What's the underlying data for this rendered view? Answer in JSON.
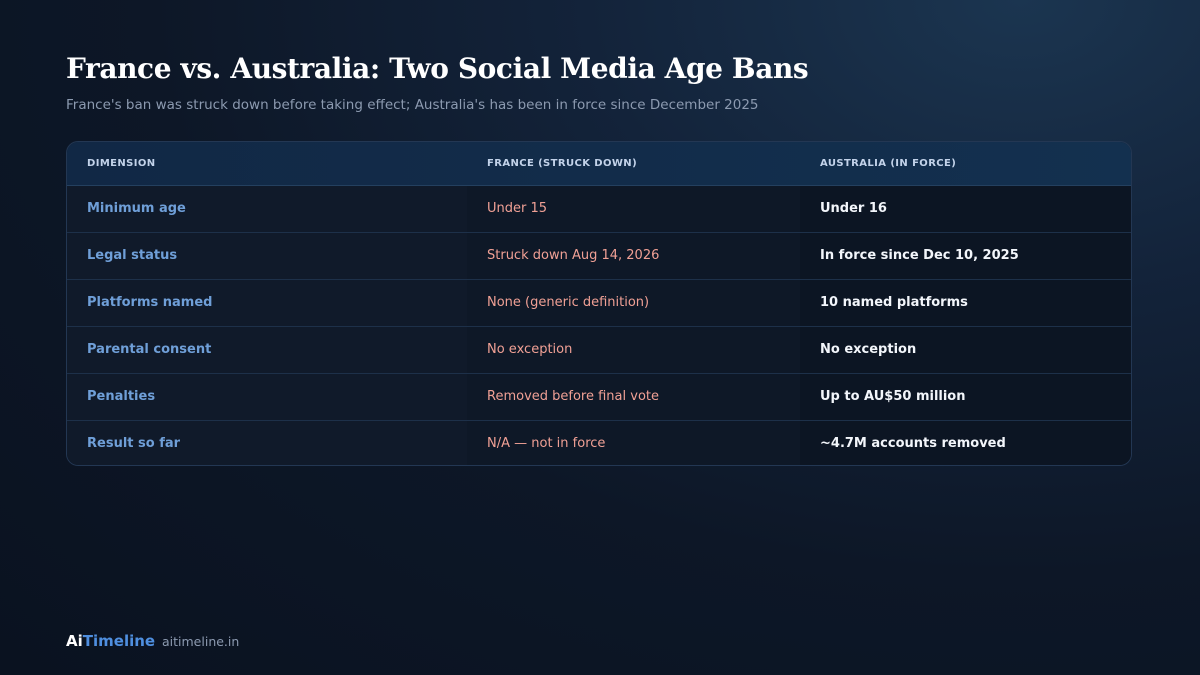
{
  "header": {
    "title": "France vs. Australia: Two Social Media Age Bans",
    "subtitle": "France's ban was struck down before taking effect; Australia's has been in force since December 2025"
  },
  "table": {
    "columns": [
      "DIMENSION",
      "FRANCE (STRUCK DOWN)",
      "AUSTRALIA (IN FORCE)"
    ],
    "rows": [
      {
        "dimension": "Minimum age",
        "france": "Under 15",
        "australia": "Under 16"
      },
      {
        "dimension": "Legal status",
        "france": "Struck down Aug 14, 2026",
        "australia": "In force since Dec 10, 2025"
      },
      {
        "dimension": "Platforms named",
        "france": "None (generic definition)",
        "australia": "10 named platforms"
      },
      {
        "dimension": "Parental consent",
        "france": "No exception",
        "australia": "No exception"
      },
      {
        "dimension": "Penalties",
        "france": "Removed before final vote",
        "australia": "Up to AU$50 million"
      },
      {
        "dimension": "Result so far",
        "france": "N/A — not in force",
        "australia": "~4.7M accounts removed"
      }
    ]
  },
  "footer": {
    "brand_ai": "Ai",
    "brand_timeline": "Timeline",
    "url": "aitimeline.in"
  },
  "colors": {
    "dimension_text": "#6f9fd8",
    "france_text": "#f0a095",
    "australia_text": "#f3f6fb",
    "brand_accent": "#4f8fe0"
  }
}
